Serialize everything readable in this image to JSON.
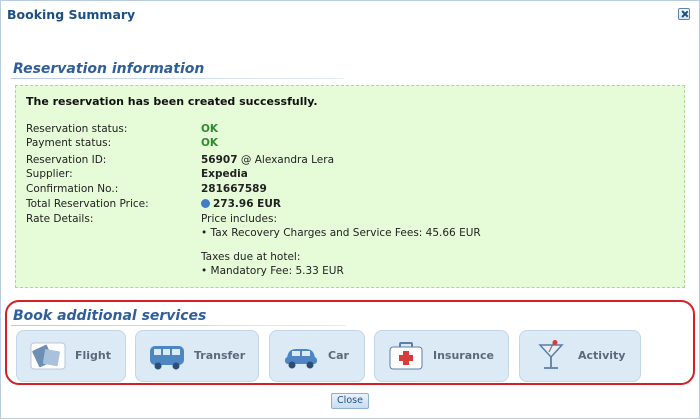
{
  "dialog": {
    "title": "Booking Summary",
    "close_label": "Close"
  },
  "reservation": {
    "section_title": "Reservation information",
    "success_message": "The reservation has been created successfully.",
    "status_label": "Reservation status:",
    "status_value": "OK",
    "payment_label": "Payment status:",
    "payment_value": "OK",
    "id_label": "Reservation ID:",
    "id_value": "56907",
    "id_agent": "@ Alexandra Lera",
    "supplier_label": "Supplier:",
    "supplier_value": "Expedia",
    "confirmation_label": "Confirmation No.:",
    "confirmation_value": "281667589",
    "price_label": "Total Reservation Price:",
    "price_value": "273.96 EUR",
    "rate_label": "Rate Details:",
    "price_includes": "Price includes:",
    "tax_item": "• Tax Recovery Charges and Service Fees: 45.66 EUR",
    "taxes_hotel": "Taxes due at hotel:",
    "mandatory_fee": "• Mandatory Fee: 5.33 EUR"
  },
  "additional": {
    "section_title": "Book additional services",
    "services": [
      {
        "label": "Flight",
        "icon": "flight-icon"
      },
      {
        "label": "Transfer",
        "icon": "bus-icon"
      },
      {
        "label": "Car",
        "icon": "car-icon"
      },
      {
        "label": "Insurance",
        "icon": "first-aid-icon"
      },
      {
        "label": "Activity",
        "icon": "cocktail-icon"
      }
    ]
  },
  "colors": {
    "accent": "#2f5f9a",
    "success_bg": "#e6fbd8",
    "ok_text": "#2f8a2f",
    "highlight": "#d71e28"
  }
}
